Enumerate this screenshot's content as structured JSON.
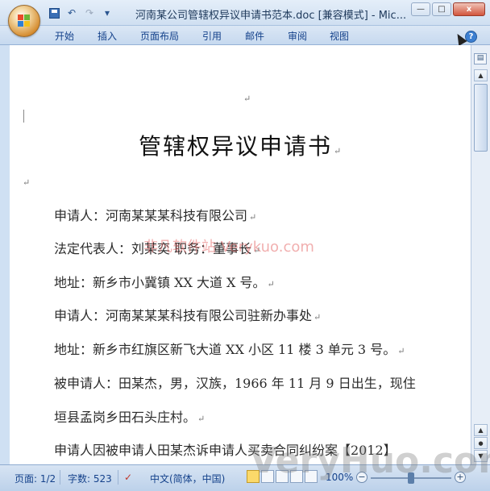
{
  "window": {
    "title": "河南某公司管辖权异议申请书范本.doc [兼容模式] - Mic...",
    "controls": {
      "minimize": "—",
      "maximize": "□",
      "close": "x"
    }
  },
  "qat": {
    "undo_glyph": "↶",
    "redo_glyph": "↷",
    "customize_glyph": "▾"
  },
  "ribbon": {
    "tabs": [
      "开始",
      "插入",
      "页面布局",
      "引用",
      "邮件",
      "审阅",
      "视图"
    ],
    "help_glyph": "?"
  },
  "document": {
    "title": "管辖权异议申请书",
    "paragraphs": [
      "申请人：河南某某某科技有限公司",
      "法定代表人：刘某奕           职务：董事长",
      "地址：新乡市小冀镇 XX 大道 X 号。",
      "申请人：河南某某某科技有限公司驻新办事处",
      "地址：新乡市红旗区新飞大道 XX 小区 11 楼 3 单元 3 号。",
      "被申请人：田某杰，男，汉族，1966 年 11 月 9 日出生，现住",
      "垣县孟岗乡田石头庄村。",
      "申请人因被申请人田某杰诉申请人买卖合同纠纷案【2012】"
    ],
    "paragraph_mark": "↵",
    "watermark": "非凡软件站 Verykuo.com"
  },
  "status": {
    "page": "页面: 1/2",
    "words": "字数: 523",
    "language": "中文(简体，中国)",
    "zoom": "100%",
    "zoom_minus": "−",
    "zoom_plus": "+",
    "watermark": "VeryHuo.com"
  },
  "icons": {
    "office": "office-button-icon",
    "save": "save-icon",
    "undo": "undo-icon",
    "redo": "redo-icon",
    "help": "help-icon"
  }
}
